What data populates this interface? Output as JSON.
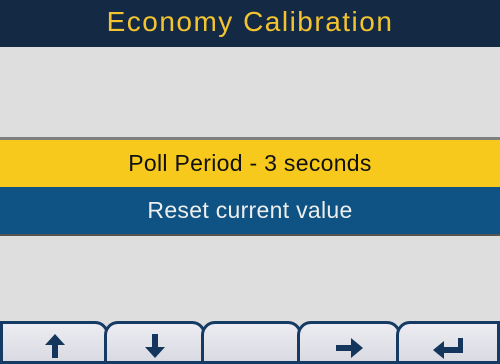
{
  "header": {
    "title": "Economy Calibration"
  },
  "menu": {
    "items": [
      {
        "label": "Poll Period - 3 seconds",
        "selected": true
      },
      {
        "label": "Reset current value",
        "selected": false
      }
    ]
  },
  "softkeys": [
    {
      "icon": "arrow-up-icon"
    },
    {
      "icon": "arrow-down-icon"
    },
    {
      "icon": ""
    },
    {
      "icon": "arrow-right-icon"
    },
    {
      "icon": "return-arrow-icon"
    }
  ],
  "colors": {
    "title_bg": "#142a44",
    "title_text": "#f4c430",
    "selected_bg": "#f6c91c",
    "item_bg": "#0e5383",
    "screen_bg": "#dedede",
    "softkey_border": "#153a63"
  }
}
